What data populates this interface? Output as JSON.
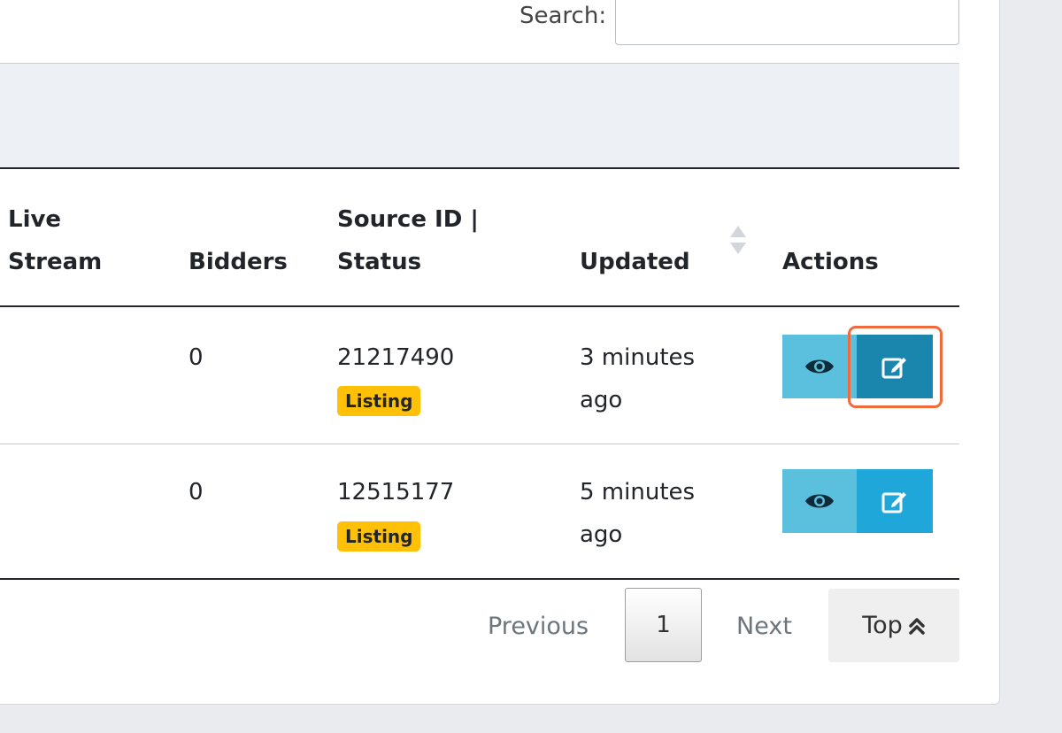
{
  "search": {
    "label": "Search:",
    "value": ""
  },
  "table": {
    "headers": {
      "live_stream_line1": "Live",
      "live_stream_line2": "Stream",
      "bidders": "Bidders",
      "source_line1": "Source ID |",
      "source_line2": "Status",
      "updated": "Updated",
      "actions": "Actions"
    },
    "rows": [
      {
        "bidders": "0",
        "source_id": "21217490",
        "status": "Listing",
        "updated_line1": "3 minutes",
        "updated_line2": "ago"
      },
      {
        "bidders": "0",
        "source_id": "12515177",
        "status": "Listing",
        "updated_line1": "5 minutes",
        "updated_line2": "ago"
      }
    ]
  },
  "pagination": {
    "previous": "Previous",
    "current": "1",
    "next": "Next",
    "top": "Top"
  },
  "colors": {
    "badge": "#ffc107",
    "view_button": "#5bc0de",
    "edit_button": "#1ea7d8",
    "edit_button_active": "#1a86ae",
    "highlight": "#f06a3b"
  },
  "icons": {
    "view": "eye-icon",
    "edit": "edit-icon",
    "sort": "sort-icon",
    "top": "double-chevron-up-icon"
  }
}
